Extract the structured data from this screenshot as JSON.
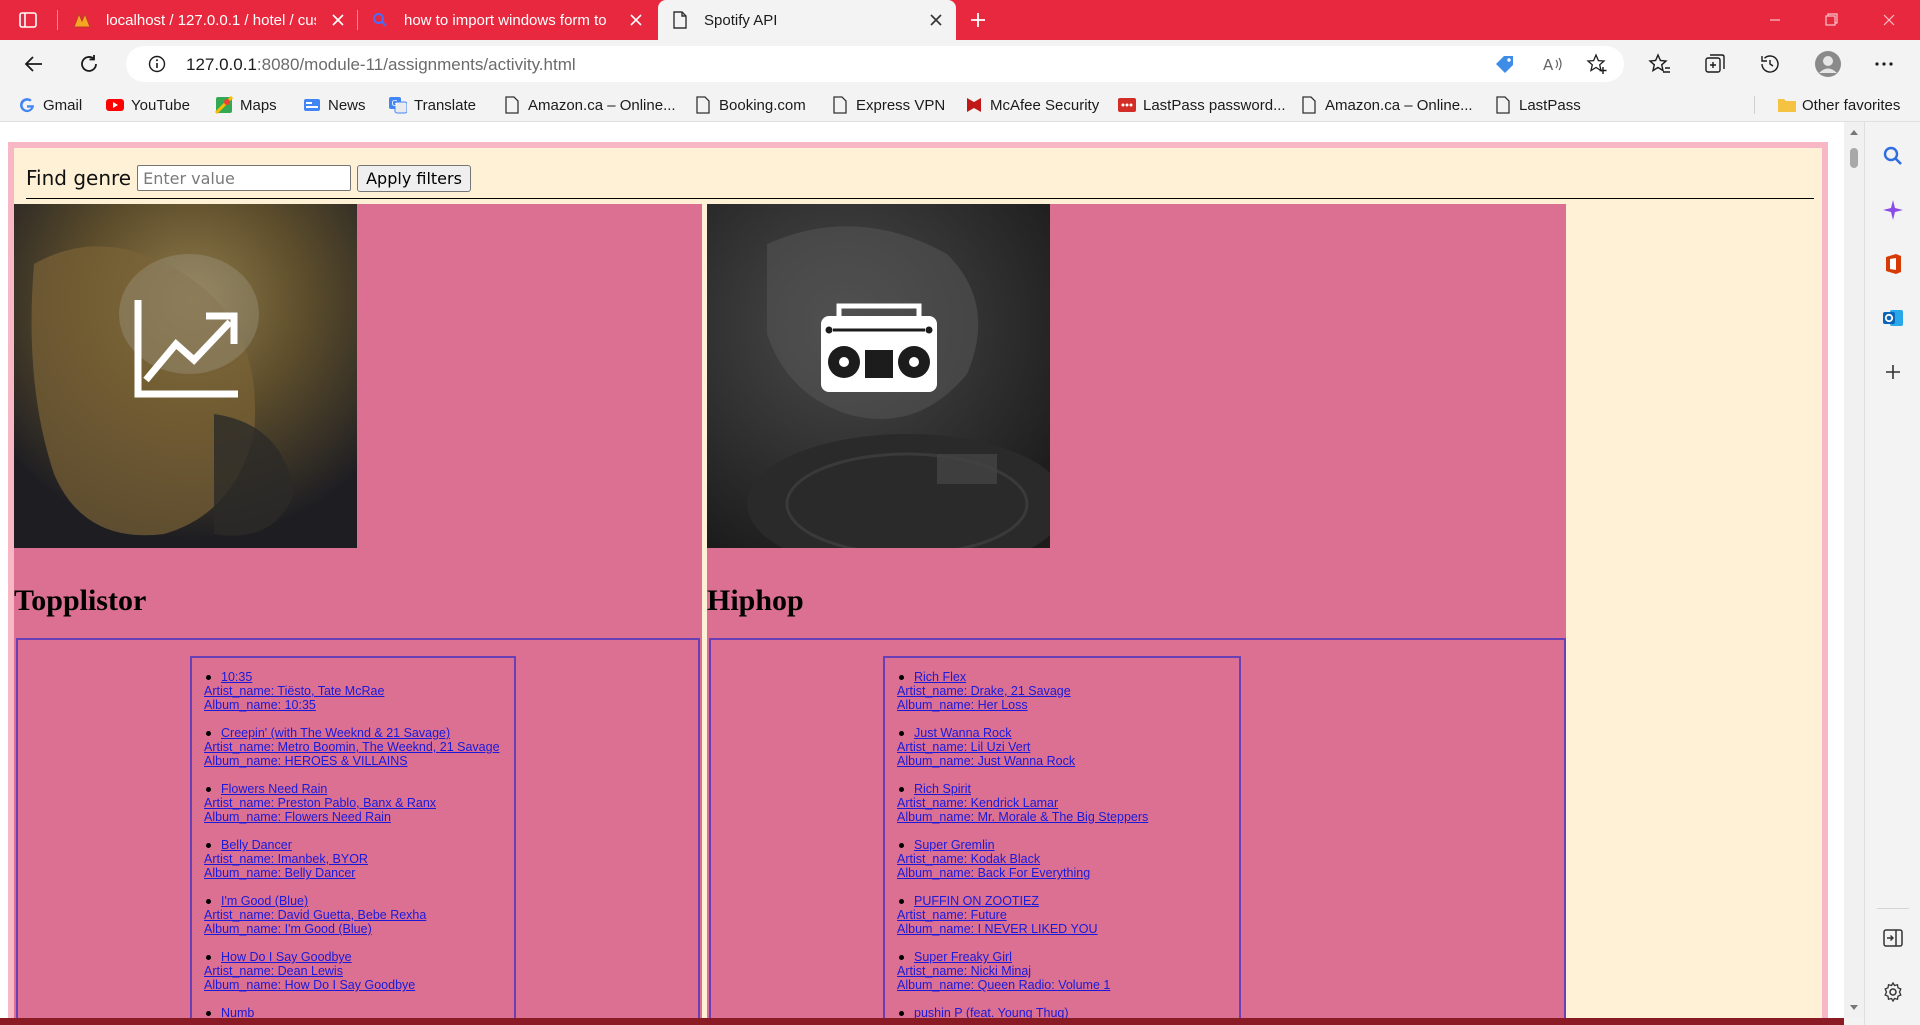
{
  "browser": {
    "tabs": [
      {
        "title": "localhost / 127.0.0.1 / hotel / cus",
        "icon": "phpmyadmin-icon"
      },
      {
        "title": "how to import windows form to",
        "icon": "search-icon"
      },
      {
        "title": "Spotify API",
        "icon": "page-icon",
        "active": true
      }
    ],
    "address": {
      "host": "127.0.0.1",
      "rest": ":8080/module-11/assignments/activity.html"
    },
    "bookmarks": [
      {
        "label": "Gmail",
        "icon": "google-icon"
      },
      {
        "label": "YouTube",
        "icon": "youtube-icon"
      },
      {
        "label": "Maps",
        "icon": "maps-icon"
      },
      {
        "label": "News",
        "icon": "news-icon"
      },
      {
        "label": "Translate",
        "icon": "translate-icon"
      },
      {
        "label": "Amazon.ca – Online...",
        "icon": "page-icon"
      },
      {
        "label": "Booking.com",
        "icon": "page-icon"
      },
      {
        "label": "Express VPN",
        "icon": "page-icon"
      },
      {
        "label": "McAfee Security",
        "icon": "mcafee-icon"
      },
      {
        "label": "LastPass password...",
        "icon": "lastpass-icon"
      },
      {
        "label": "Amazon.ca – Online...",
        "icon": "page-icon"
      },
      {
        "label": "LastPass",
        "icon": "page-icon"
      }
    ],
    "other_favorites": "Other favorites",
    "colors": {
      "tabbar": "#e8283e",
      "page_background": "#fff1d6",
      "card": "#db7093",
      "frame": "#f7b7c5",
      "link": "#1a1ad8"
    }
  },
  "filter": {
    "label": "Find genre",
    "placeholder": "Enter value",
    "button": "Apply filters"
  },
  "genres": [
    {
      "title": "Topplistor",
      "image_icon": "trending-chart-icon",
      "tracks": [
        {
          "name": "10:35",
          "artist": "Artist_name: Tiësto, Tate McRae",
          "album": "Album_name: 10:35"
        },
        {
          "name": "Creepin' (with The Weeknd & 21 Savage)",
          "artist": "Artist_name: Metro Boomin, The Weeknd, 21 Savage",
          "album": "Album_name: HEROES & VILLAINS"
        },
        {
          "name": "Flowers Need Rain",
          "artist": "Artist_name: Preston Pablo, Banx & Ranx",
          "album": "Album_name: Flowers Need Rain"
        },
        {
          "name": "Belly Dancer",
          "artist": "Artist_name: Imanbek, BYOR",
          "album": "Album_name: Belly Dancer"
        },
        {
          "name": "I'm Good (Blue)",
          "artist": "Artist_name: David Guetta, Bebe Rexha",
          "album": "Album_name: I'm Good (Blue)"
        },
        {
          "name": "How Do I Say Goodbye",
          "artist": "Artist_name: Dean Lewis",
          "album": "Album_name: How Do I Say Goodbye"
        },
        {
          "name": "Numb",
          "artist": "",
          "album": ""
        }
      ]
    },
    {
      "title": "Hiphop",
      "image_icon": "boombox-icon",
      "tracks": [
        {
          "name": "Rich Flex",
          "artist": "Artist_name: Drake, 21 Savage",
          "album": "Album_name: Her Loss"
        },
        {
          "name": "Just Wanna Rock",
          "artist": "Artist_name: Lil Uzi Vert",
          "album": "Album_name: Just Wanna Rock"
        },
        {
          "name": "Rich Spirit",
          "artist": "Artist_name: Kendrick Lamar",
          "album": "Album_name: Mr. Morale & The Big Steppers"
        },
        {
          "name": "Super Gremlin",
          "artist": "Artist_name: Kodak Black",
          "album": "Album_name: Back For Everything"
        },
        {
          "name": "PUFFIN ON ZOOTIEZ",
          "artist": "Artist_name: Future",
          "album": "Album_name: I NEVER LIKED YOU"
        },
        {
          "name": "Super Freaky Girl",
          "artist": "Artist_name: Nicki Minaj",
          "album": "Album_name: Queen Radio: Volume 1"
        },
        {
          "name": "pushin P (feat. Young Thug)",
          "artist": "",
          "album": ""
        }
      ]
    }
  ]
}
